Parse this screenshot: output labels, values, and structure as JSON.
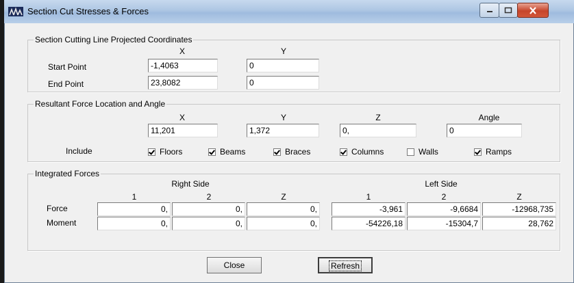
{
  "window": {
    "title": "Section Cut Stresses & Forces",
    "title_icon": "etabs-app-icon"
  },
  "controls": {
    "minimize_icon": "minimize-icon",
    "maximize_icon": "maximize-icon",
    "close_icon": "close-icon"
  },
  "section_cutting": {
    "legend": "Section Cutting Line Projected Coordinates",
    "col_x": "X",
    "col_y": "Y",
    "start_label": "Start Point",
    "start_x": "-1,4063",
    "start_y": "0",
    "end_label": "End Point",
    "end_x": "23,8082",
    "end_y": "0"
  },
  "resultant": {
    "legend": "Resultant Force Location and Angle",
    "col_x": "X",
    "col_y": "Y",
    "col_z": "Z",
    "col_angle": "Angle",
    "x": "11,201",
    "y": "1,372",
    "z": "0,",
    "angle": "0",
    "include_label": "Include",
    "checks": [
      {
        "label": "Floors",
        "checked": true
      },
      {
        "label": "Beams",
        "checked": true
      },
      {
        "label": "Braces",
        "checked": true
      },
      {
        "label": "Columns",
        "checked": true
      },
      {
        "label": "Walls",
        "checked": false
      },
      {
        "label": "Ramps",
        "checked": true
      }
    ]
  },
  "integrated": {
    "legend": "Integrated Forces",
    "right_side": "Right Side",
    "left_side": "Left Side",
    "cols": [
      "1",
      "2",
      "Z",
      "1",
      "2",
      "Z"
    ],
    "force_label": "Force",
    "moment_label": "Moment",
    "force": [
      "0,",
      "0,",
      "0,",
      "-3,961",
      "-9,6684",
      "-12968,735"
    ],
    "moment": [
      "0,",
      "0,",
      "0,",
      "-54226,18",
      "-15304,7",
      "28,762"
    ]
  },
  "buttons": {
    "close": "Close",
    "refresh": "Refresh"
  }
}
